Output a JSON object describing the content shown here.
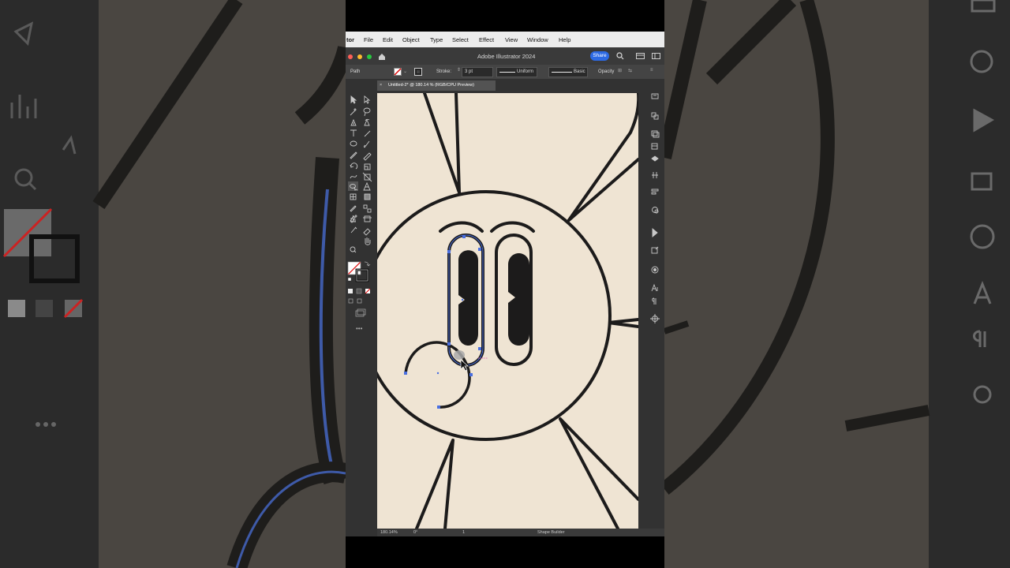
{
  "app": {
    "window_title": "Adobe Illustrator 2024",
    "app_menu_fragment": "tor",
    "share_label": "Share",
    "colors": {
      "accent": "#2d6ae3",
      "artboard": "#efe4d3",
      "stroke": "#1c1b1b",
      "selection": "#4a6fe0"
    }
  },
  "menu": {
    "file": "File",
    "edit": "Edit",
    "object": "Object",
    "type": "Type",
    "select": "Select",
    "effect": "Effect",
    "view": "View",
    "window": "Window",
    "help": "Help"
  },
  "control_bar": {
    "selection_type": "Path",
    "stroke_label": "Stroke:",
    "stroke_value": "3 pt",
    "profile_label": "Uniform",
    "brush_label": "Basic",
    "opacity_label": "Opacity"
  },
  "document_tab": {
    "title": "Untitled-2* @ 180.14 % (RGB/CPU Preview)"
  },
  "status_bar": {
    "zoom": "180.14%",
    "rotation": "0°",
    "artboard_number": "1",
    "current_tool": "Shape Builder"
  },
  "toolbar": {
    "tools": [
      "selection-tool",
      "direct-selection-tool",
      "magic-wand-tool",
      "lasso-tool",
      "pen-tool",
      "curvature-tool",
      "type-tool",
      "line-segment-tool",
      "ellipse-tool",
      "paintbrush-tool",
      "shaper-tool",
      "pencil-tool",
      "rotate-tool",
      "scale-tool",
      "warp-tool",
      "free-transform-tool",
      "shape-builder-tool",
      "perspective-grid-tool",
      "mesh-tool",
      "gradient-tool",
      "eyedropper-tool",
      "blend-tool",
      "symbol-sprayer-tool",
      "column-graph-tool",
      "artboard-tool",
      "slice-tool",
      "eraser-tool",
      "hand-tool",
      "zoom-tool"
    ],
    "more_label": "•••"
  },
  "right_panel": {
    "icons": [
      "properties-icon",
      "libraries-icon",
      "layers-icon",
      "artboards-icon",
      "asset-export-icon",
      "transform-icon",
      "align-icon",
      "pathfinder-icon",
      "gradient-icon",
      "color-icon",
      "actions-icon",
      "transparency-icon",
      "appearance-icon",
      "character-icon",
      "paragraph-icon",
      "symbols-icon"
    ]
  }
}
